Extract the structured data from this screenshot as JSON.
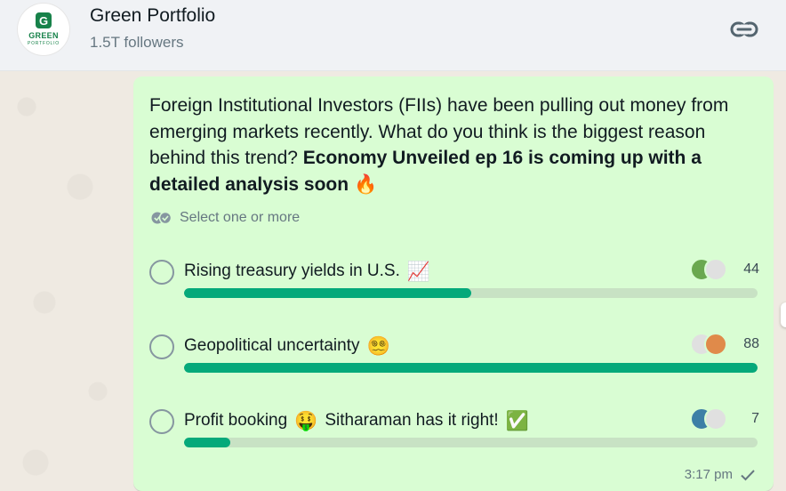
{
  "channel": {
    "name": "Green Portfolio",
    "followers": "1.5T followers",
    "avatar_letter": "G",
    "avatar_brand": "GREEN",
    "avatar_sub": "PORTFOLIO"
  },
  "poll": {
    "question_plain": "Foreign Institutional Investors (FIIs) have been pulling out money from emerging markets recently. What do you think is the biggest reason behind this trend? ",
    "question_bold": "Economy Unveiled ep 16 is coming up with a detailed analysis soon",
    "question_emoji": "🔥",
    "select_hint": "Select one or more",
    "options": [
      {
        "label": "Rising treasury yields in U.S.",
        "emoji": "📈",
        "suffix": "",
        "suffix_emoji": "",
        "votes": "44",
        "fill_fraction": 0.5,
        "voter_colors": [
          "#6aa84f",
          "#e0e0e0"
        ]
      },
      {
        "label": "Geopolitical uncertainty",
        "emoji": "😵‍💫",
        "suffix": "",
        "suffix_emoji": "",
        "votes": "88",
        "fill_fraction": 1.0,
        "voter_colors": [
          "#e0e0e0",
          "#e08a4a"
        ]
      },
      {
        "label": "Profit booking",
        "emoji": "🤑",
        "suffix": "Sitharaman has it right!",
        "suffix_emoji": "✅",
        "votes": "7",
        "fill_fraction": 0.08,
        "voter_colors": [
          "#3d7fa6",
          "#e0e0e0"
        ]
      }
    ],
    "time": "3:17 pm"
  },
  "colors": {
    "bubble": "#d9fdd3",
    "bar_fill": "#05a97a",
    "bar_track": "#c8e2c4",
    "header": "#f0f2f5"
  },
  "icons": {
    "header_action": "link-icon",
    "hint": "double-check-icon",
    "status": "check-icon"
  }
}
